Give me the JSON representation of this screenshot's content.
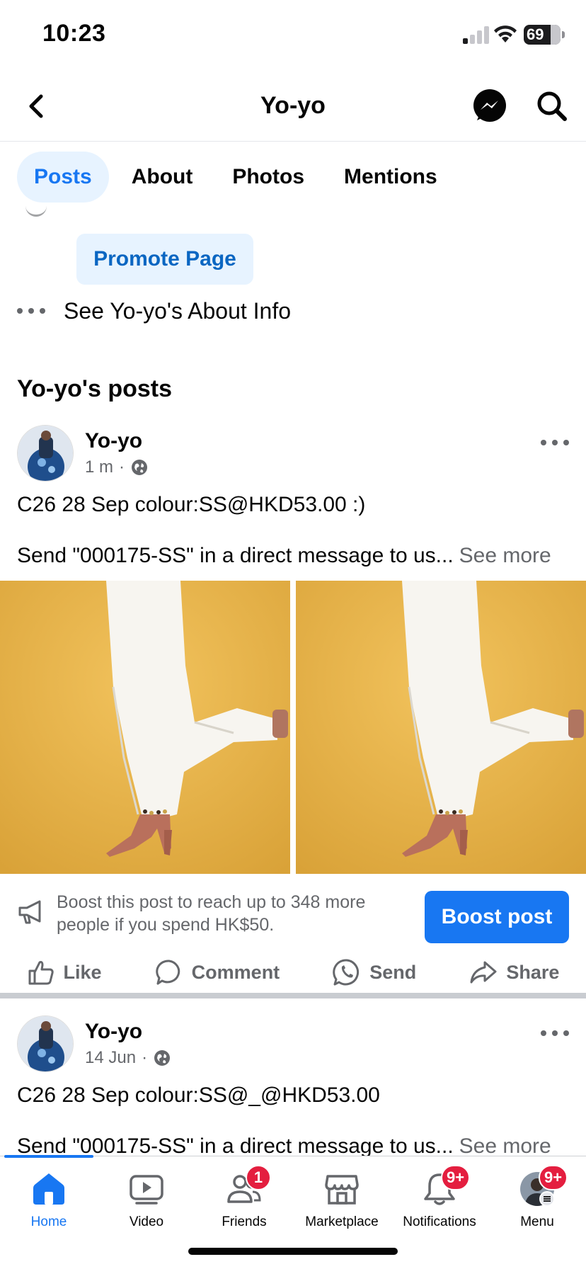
{
  "status_bar": {
    "time": "10:23",
    "battery": "69"
  },
  "header": {
    "title": "Yo-yo"
  },
  "tabs": [
    {
      "label": "Posts",
      "active": true
    },
    {
      "label": "About",
      "active": false
    },
    {
      "label": "Photos",
      "active": false
    },
    {
      "label": "Mentions",
      "active": false
    }
  ],
  "promote": {
    "label": "Promote Page"
  },
  "about_row": {
    "label": "See Yo-yo's About Info"
  },
  "section": {
    "title": "Yo-yo's posts"
  },
  "posts": [
    {
      "author": "Yo-yo",
      "time": "1 m",
      "line1": "C26 28 Sep colour:SS@HKD53.00 :)",
      "line2": "Send \"000175-SS\" in a direct message to us...",
      "see_more": "See more",
      "boost_text": "Boost this post to reach up to 348 more people if you spend HK$50.",
      "boost_button": "Boost post",
      "actions": [
        "Like",
        "Comment",
        "Send",
        "Share"
      ]
    },
    {
      "author": "Yo-yo",
      "time": "14 Jun",
      "line1": "C26 28 Sep colour:SS@_@HKD53.00",
      "line2": "Send \"000175-SS\" in a direct message to us...",
      "see_more": "See more"
    }
  ],
  "bottom_nav": [
    {
      "label": "Home",
      "icon": "home-icon",
      "active": true,
      "badge": ""
    },
    {
      "label": "Video",
      "icon": "video-icon",
      "active": false,
      "badge": ""
    },
    {
      "label": "Friends",
      "icon": "friends-icon",
      "active": false,
      "badge": "1"
    },
    {
      "label": "Marketplace",
      "icon": "marketplace-icon",
      "active": false,
      "badge": ""
    },
    {
      "label": "Notifications",
      "icon": "bell-icon",
      "active": false,
      "badge": "9+"
    },
    {
      "label": "Menu",
      "icon": "profile-menu-icon",
      "active": false,
      "badge": "9+"
    }
  ],
  "colors": {
    "accent": "#1877f2",
    "badge": "#e41e3f",
    "tab_active_bg": "#e7f3ff",
    "photo_bg": "#e9b94a"
  }
}
